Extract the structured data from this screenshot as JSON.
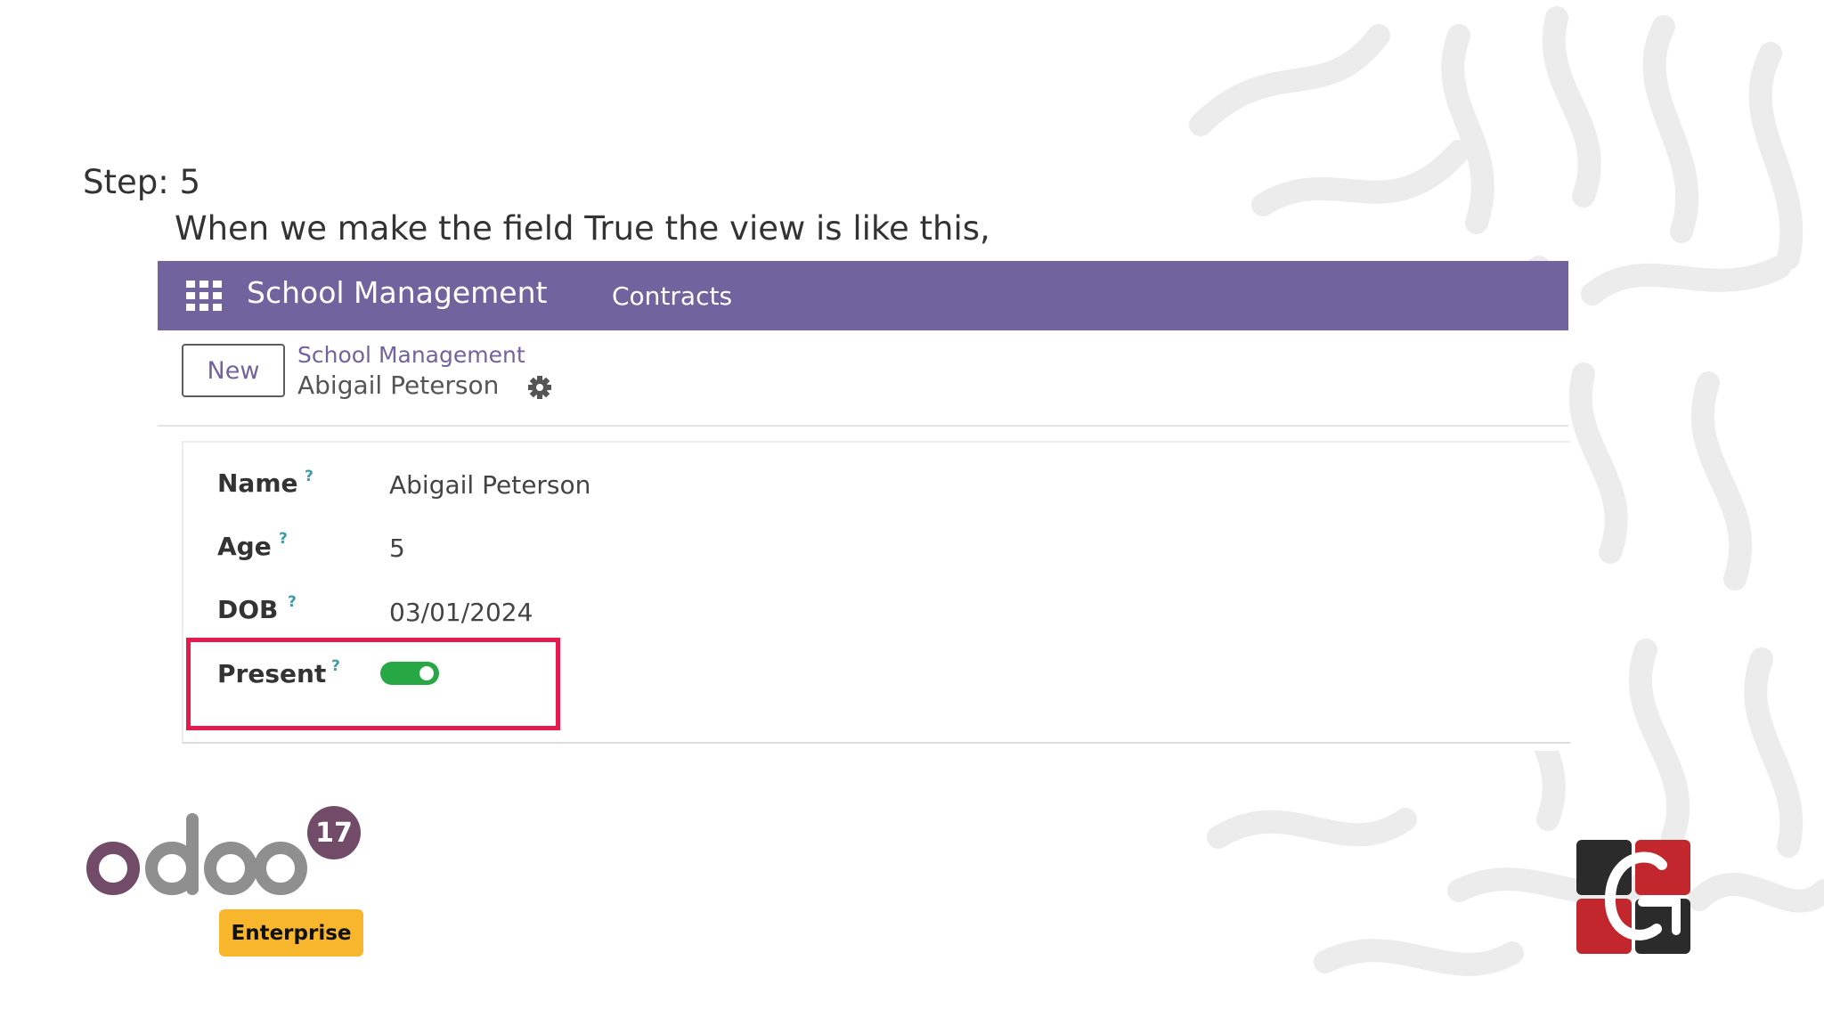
{
  "slide": {
    "step_label": "Step: 5",
    "description": "When we make the field True the view is like this,"
  },
  "navbar": {
    "apps_icon": "grid-icon",
    "title": "School Management",
    "menu_item": "Contracts",
    "color": "#71639e"
  },
  "control_panel": {
    "new_button": "New",
    "breadcrumb_parent": "School Management",
    "breadcrumb_current": "Abigail Peterson",
    "settings_icon": "gear-icon"
  },
  "form": {
    "fields": [
      {
        "label": "Name",
        "help": "?",
        "value": "Abigail Peterson"
      },
      {
        "label": "Age",
        "help": "?",
        "value": "5"
      },
      {
        "label": "DOB",
        "help": "?",
        "value": "03/01/2024"
      },
      {
        "label": "Present",
        "help": "?",
        "value": true
      }
    ],
    "toggle_color": "#28a745",
    "highlight_color": "#e5194b"
  },
  "branding": {
    "logo": "odoo",
    "version": "17",
    "edition": "Enterprise",
    "company_logo": "cg-logo"
  }
}
